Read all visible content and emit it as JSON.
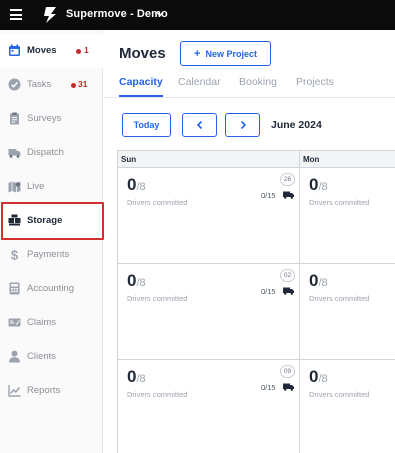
{
  "app": {
    "title": "Supermove - Demo"
  },
  "sidebar": {
    "items": [
      {
        "label": "Moves",
        "icon": "calendar-icon",
        "badge": "1",
        "active": true
      },
      {
        "label": "Tasks",
        "icon": "check-circle-icon",
        "badge": "31"
      },
      {
        "label": "Surveys",
        "icon": "clipboard-icon"
      },
      {
        "label": "Dispatch",
        "icon": "truck-icon"
      },
      {
        "label": "Live",
        "icon": "map-icon"
      },
      {
        "label": "Storage",
        "icon": "boxes-icon",
        "highlighted": true
      },
      {
        "label": "Payments",
        "icon": "dollar-icon"
      },
      {
        "label": "Accounting",
        "icon": "calculator-icon"
      },
      {
        "label": "Claims",
        "icon": "claims-icon"
      },
      {
        "label": "Clients",
        "icon": "user-icon"
      },
      {
        "label": "Reports",
        "icon": "chart-icon"
      }
    ]
  },
  "main": {
    "title": "Moves",
    "new_project_label": "New Project",
    "tabs": [
      {
        "label": "Capacity",
        "active": true
      },
      {
        "label": "Calendar"
      },
      {
        "label": "Booking"
      },
      {
        "label": "Projects"
      }
    ],
    "toolbar": {
      "today_label": "Today",
      "month_label": "June 2024"
    },
    "calendar": {
      "days": [
        "Sun",
        "Mon"
      ],
      "rows": [
        {
          "sun": {
            "committed": "0",
            "total": "/8",
            "sub": "Drivers committed",
            "date": "26",
            "trucks": "0/15"
          },
          "mon": {
            "committed": "0",
            "total": "/8",
            "sub": "Drivers committed"
          }
        },
        {
          "sun": {
            "committed": "0",
            "total": "/8",
            "sub": "Drivers committed",
            "date": "02",
            "trucks": "0/15"
          },
          "mon": {
            "committed": "0",
            "total": "/8",
            "sub": "Drivers committed"
          }
        },
        {
          "sun": {
            "committed": "0",
            "total": "/8",
            "sub": "Drivers committed",
            "date": "09",
            "trucks": "0/15"
          },
          "mon": {
            "committed": "0",
            "total": "/8",
            "sub": "Drivers committed"
          }
        }
      ]
    }
  },
  "colors": {
    "accent": "#2563eb",
    "badge": "#c62828",
    "highlight": "#d32f2f",
    "topbar": "#0b0b0b"
  }
}
